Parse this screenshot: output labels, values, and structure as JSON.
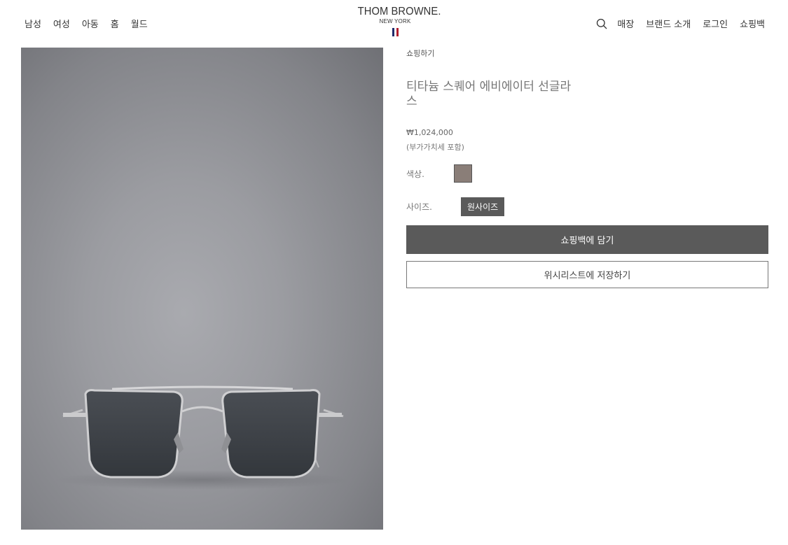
{
  "header": {
    "nav_left": [
      "남성",
      "여성",
      "아동",
      "홈",
      "월드"
    ],
    "logo": {
      "main": "THOM BROWNE.",
      "sub": "NEW YORK"
    },
    "flag_colors": [
      "#1f2b6b",
      "#ffffff",
      "#b11e2e"
    ],
    "search_icon": "search-icon",
    "nav_right": [
      "매장",
      "브랜드 소개",
      "로그인",
      "쇼핑백"
    ]
  },
  "product": {
    "breadcrumb": "쇼핑하기",
    "title": "티타늄 스퀘어 에비에이터 선글라스",
    "price": "₩1,024,000",
    "vat_note": "(부가가치세 포함)",
    "color_label": "색상.",
    "color_swatch": "#8a7e78",
    "size_label": "사이즈.",
    "size_value": "원사이즈",
    "add_to_bag": "쇼핑백에 담기",
    "add_to_wishlist": "위시리스트에 저장하기"
  },
  "colors": {
    "primary_button": "#5a5a5a",
    "text": "#333333"
  }
}
